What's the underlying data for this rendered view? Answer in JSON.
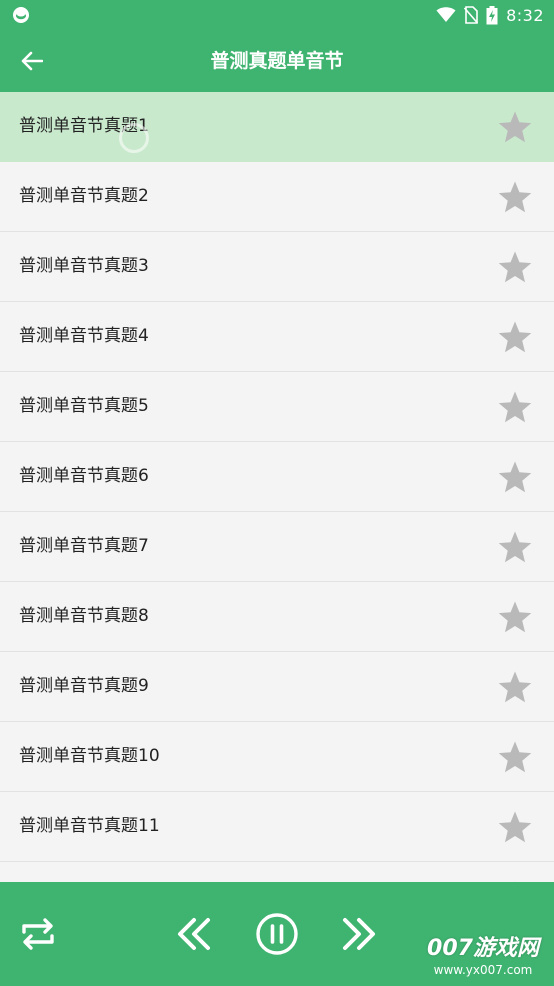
{
  "status_bar": {
    "time": "8:32",
    "icons": [
      "app-notification-icon",
      "wifi-icon",
      "no-sim-icon",
      "battery-charging-icon"
    ]
  },
  "app_bar": {
    "back_icon": "back-arrow-icon",
    "title": "普测真题单音节"
  },
  "list": {
    "items": [
      {
        "label": "普测单音节真题1",
        "starred": false,
        "active": true
      },
      {
        "label": "普测单音节真题2",
        "starred": false
      },
      {
        "label": "普测单音节真题3",
        "starred": false
      },
      {
        "label": "普测单音节真题4",
        "starred": false
      },
      {
        "label": "普测单音节真题5",
        "starred": false
      },
      {
        "label": "普测单音节真题6",
        "starred": false
      },
      {
        "label": "普测单音节真题7",
        "starred": false
      },
      {
        "label": "普测单音节真题8",
        "starred": false
      },
      {
        "label": "普测单音节真题9",
        "starred": false
      },
      {
        "label": "普测单音节真题10",
        "starred": false
      },
      {
        "label": "普测单音节真题11",
        "starred": false
      }
    ]
  },
  "player": {
    "controls": [
      "repeat-icon",
      "previous-icon",
      "pause-icon",
      "next-icon"
    ]
  },
  "watermark": {
    "main": "007游戏网",
    "sub": "www.yx007.com"
  },
  "colors": {
    "primary": "#3fb370",
    "active_row": "#c9e9cd",
    "star": "#b9b9b9",
    "background": "#f4f4f4"
  }
}
